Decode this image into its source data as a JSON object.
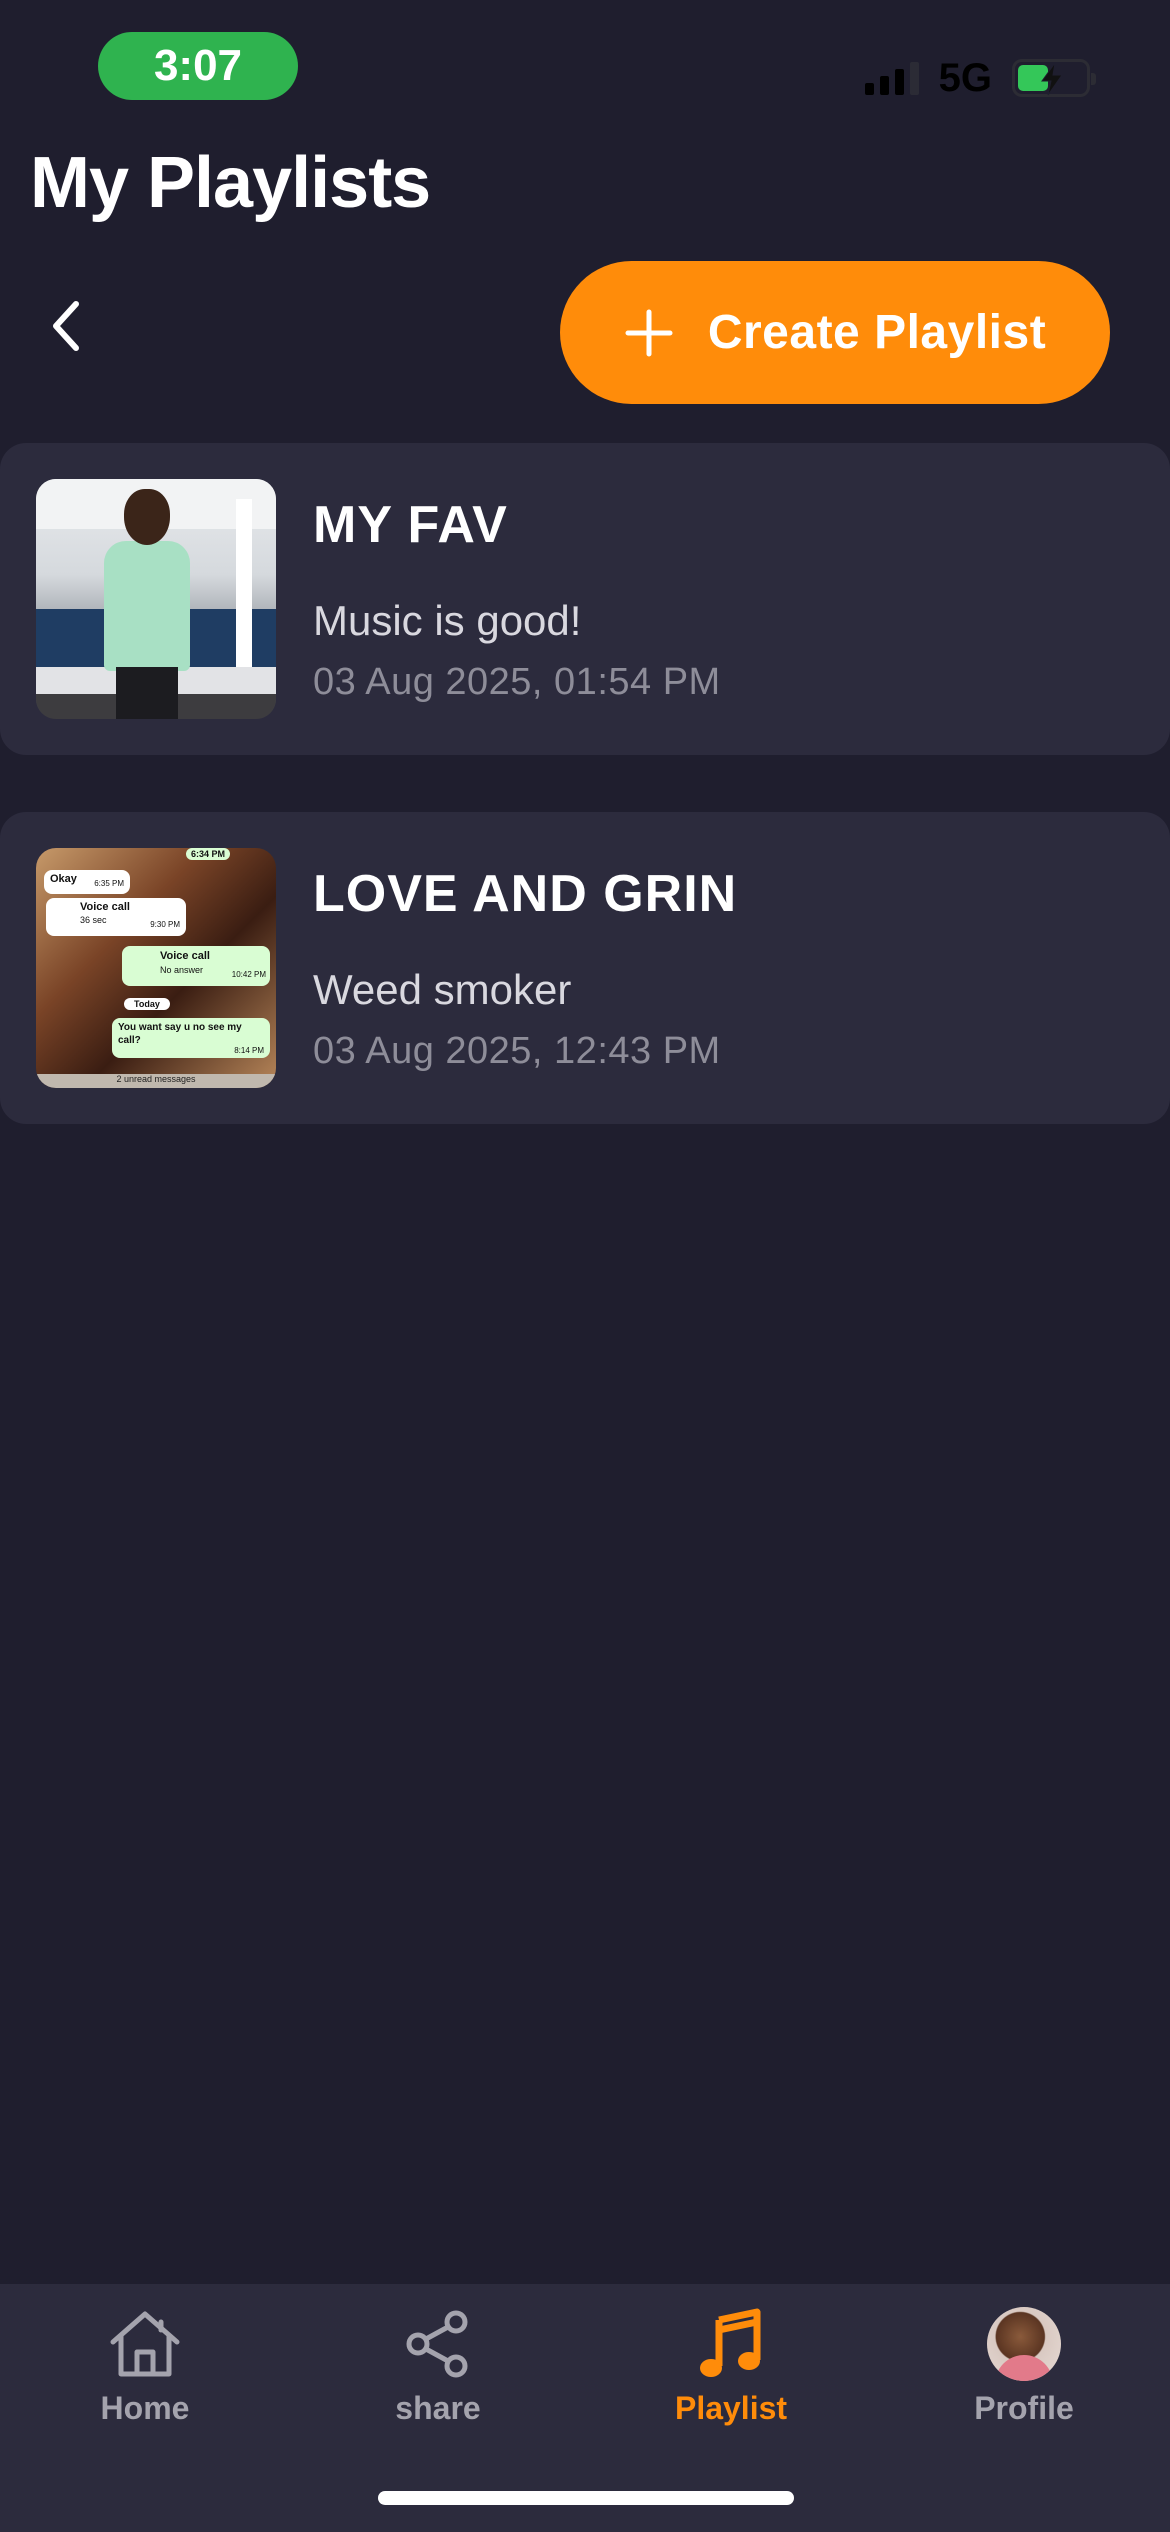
{
  "status_bar": {
    "time": "3:07",
    "network": "5G",
    "signal_icon": "cellular-signal-icon",
    "battery_icon": "battery-charging-icon"
  },
  "header": {
    "title": "My Playlists",
    "back_icon": "chevron-left-icon",
    "create_button": {
      "label": "Create Playlist",
      "icon": "plus-icon"
    }
  },
  "playlists": [
    {
      "name": "MY FAV",
      "description": "Music is good!",
      "date": "03 Aug 2025, 01:54 PM"
    },
    {
      "name": "LOVE AND GRIN",
      "description": "Weed smoker",
      "date": "03 Aug 2025, 12:43 PM"
    }
  ],
  "thumbnail_2_text": {
    "okay": "Okay",
    "okay_time": "6:35 PM",
    "voice_call": "Voice call",
    "voice_call_dur": "36 sec",
    "voice_call_time": "9:30 PM",
    "voice_call_2": "Voice call",
    "no_answer": "No answer",
    "voice_call_2_time": "10:42 PM",
    "today": "Today",
    "msg": "You want say u no see my call?",
    "msg_time": "8:14 PM",
    "top_time": "6:34 PM",
    "unread": "2 unread messages"
  },
  "bottom_nav": {
    "items": [
      {
        "label": "Home",
        "icon": "home-icon"
      },
      {
        "label": "share",
        "icon": "share-icon"
      },
      {
        "label": "Playlist",
        "icon": "music-note-icon"
      },
      {
        "label": "Profile",
        "icon": "avatar"
      }
    ],
    "active_index": 2
  },
  "colors": {
    "background": "#1f1e2e",
    "card": "#2c2b3d",
    "accent": "#ff8c0a",
    "time_pill": "#2fb34f",
    "muted_text": "#8e8d99",
    "nav_inactive": "#a4a3ad"
  }
}
